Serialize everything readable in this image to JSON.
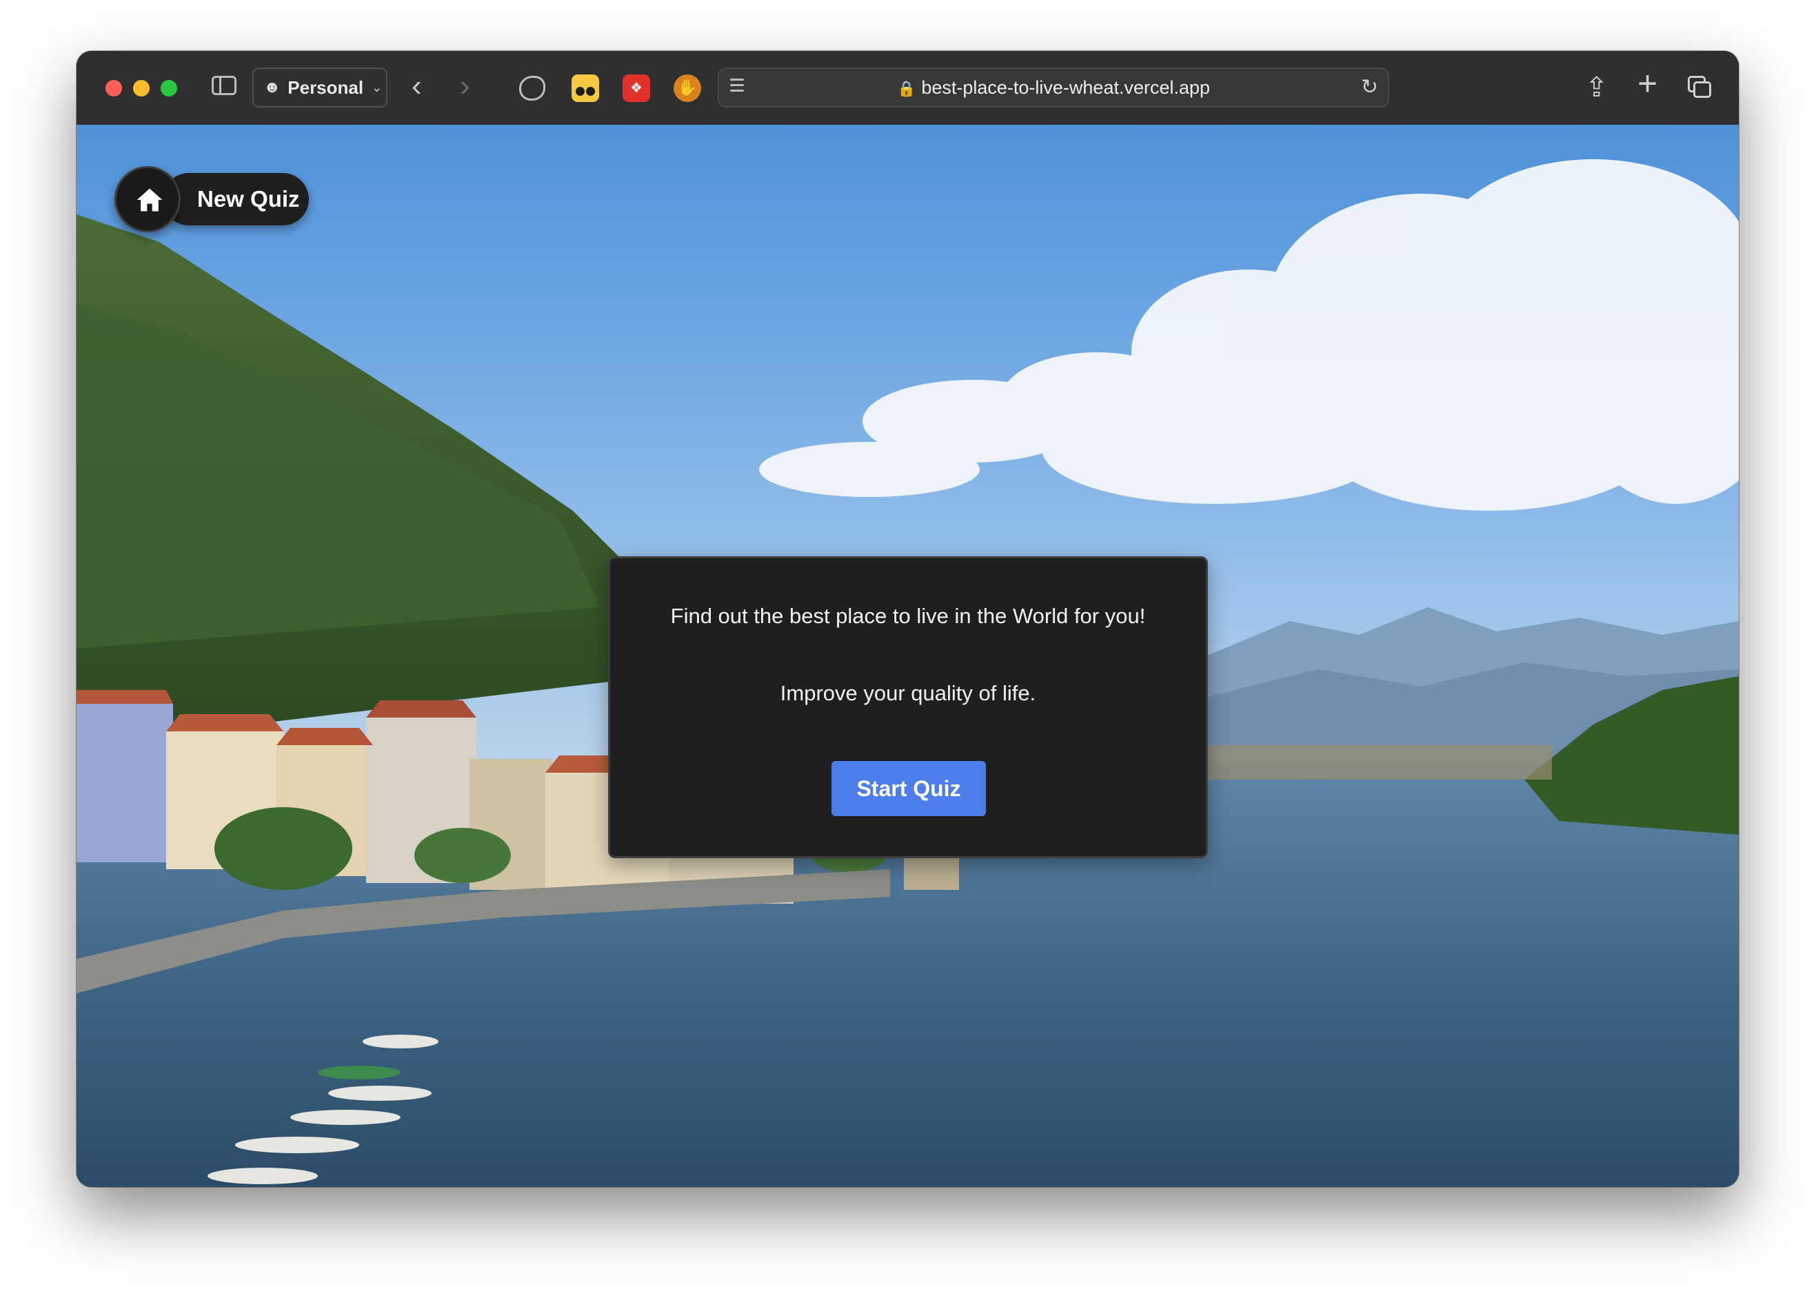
{
  "browser": {
    "profile_label": "Personal",
    "url": "best-place-to-live-wheat.vercel.app",
    "extensions": [
      "clipper-icon",
      "eyes-extension-icon",
      "mendeley-extension-icon",
      "hand-stop-extension-icon"
    ],
    "colors": {
      "toolbar": "#2f2f2f",
      "close": "#ff5f57",
      "minimize": "#febc2e",
      "zoom": "#28c840"
    }
  },
  "page": {
    "home_button_label": "New Quiz",
    "card": {
      "headline": "Find out the best place to live in the World for you!",
      "subline": "Improve your quality of life.",
      "start_label": "Start Quiz"
    },
    "colors": {
      "accent": "#4c7dea",
      "card_bg": "#1f1f1f"
    }
  }
}
